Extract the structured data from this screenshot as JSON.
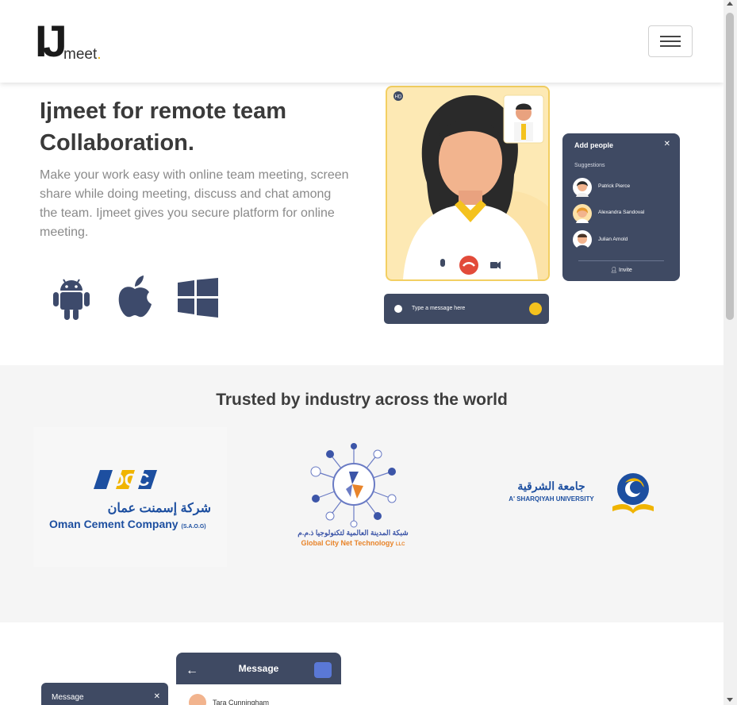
{
  "navbar": {
    "logo_main": "IJ",
    "logo_sub": "meet",
    "logo_dot": ".",
    "menu_icon": "hamburger-icon"
  },
  "hero": {
    "title_line1": "Ijmeet for remote team",
    "title_line2": "Collaboration.",
    "description": "Make your work easy with online team meeting, screen share while doing meeting, discuss and chat among the team. Ijmeet gives you secure platform for online meeting.",
    "platforms": [
      {
        "name": "android",
        "icon": "android-icon"
      },
      {
        "name": "apple",
        "icon": "apple-icon"
      },
      {
        "name": "windows",
        "icon": "windows-icon"
      }
    ]
  },
  "illustration": {
    "badge": "HD",
    "add_people_title": "Add people",
    "suggestions_label": "Suggestions",
    "people": [
      "Patrick Pierce",
      "Alexandra Sandoval",
      "Julian Arnold"
    ],
    "invite_label": "Invite",
    "chat_placeholder": "Type a message here"
  },
  "trusted": {
    "title": "Trusted by industry across the world",
    "clients": [
      {
        "logo_text": "OCC",
        "arabic": "شركة إسمنت عمان",
        "name": "Oman Cement Company",
        "suffix": "(S.A.O.G)"
      },
      {
        "arabic": "شبكة المدينة العالمية لتكنولوجيا ذ.م.م",
        "name": "Global City Net Technology",
        "suffix": "LLC"
      },
      {
        "arabic": "جامعة الشرقية",
        "name": "A' SHARQIYAH UNIVERSITY"
      }
    ]
  },
  "bottom": {
    "message_title": "Message",
    "message_title_small": "Message",
    "contact": "Tara Cunningham"
  },
  "colors": {
    "navy": "#3f4a63",
    "yellow": "#f3cf62",
    "orange": "#f0b400",
    "blue": "#1d4fa0"
  }
}
